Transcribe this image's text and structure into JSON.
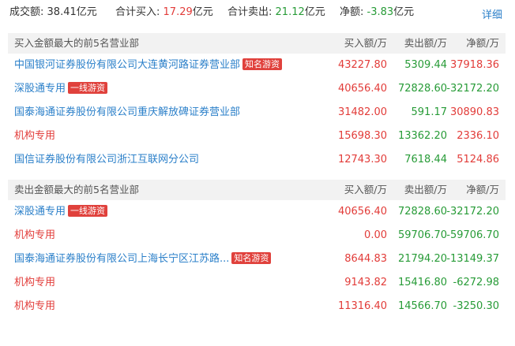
{
  "summary": {
    "turnover_label": "成交额:",
    "turnover_value": "38.41亿元",
    "buy_label": "合计买入:",
    "buy_value": "17.29",
    "buy_unit": "亿元",
    "sell_label": "合计卖出:",
    "sell_value": "21.12",
    "sell_unit": "亿元",
    "net_label": "净额:",
    "net_value": "-3.83",
    "net_unit": "亿元",
    "detail_link": "详细"
  },
  "columns": {
    "buy": "买入额/万",
    "sell": "卖出额/万",
    "net": "净额/万"
  },
  "buy_section": {
    "title": "买入金额最大的前5名营业部",
    "rows": [
      {
        "name": "中国银河证券股份有限公司大连黄河路证券营业部",
        "badge": "知名游资",
        "buy": "43227.80",
        "sell": "5309.44",
        "net": "37918.36"
      },
      {
        "name": "深股通专用",
        "badge": "一线游资",
        "buy": "40656.40",
        "sell": "72828.60",
        "net": "-32172.20"
      },
      {
        "name": "国泰海通证券股份有限公司重庆解放碑证券营业部",
        "badge": "",
        "buy": "31482.00",
        "sell": "591.17",
        "net": "30890.83"
      },
      {
        "name": "机构专用",
        "badge": "",
        "buy": "15698.30",
        "sell": "13362.20",
        "net": "2336.10"
      },
      {
        "name": "国信证券股份有限公司浙江互联网分公司",
        "badge": "",
        "buy": "12743.30",
        "sell": "7618.44",
        "net": "5124.86"
      }
    ]
  },
  "sell_section": {
    "title": "卖出金额最大的前5名营业部",
    "rows": [
      {
        "name": "深股通专用",
        "badge": "一线游资",
        "buy": "40656.40",
        "sell": "72828.60",
        "net": "-32172.20"
      },
      {
        "name": "机构专用",
        "badge": "",
        "buy": "0.00",
        "sell": "59706.70",
        "net": "-59706.70"
      },
      {
        "name": "国泰海通证券股份有限公司上海长宁区江苏路...",
        "badge": "知名游资",
        "buy": "8644.83",
        "sell": "21794.20",
        "net": "-13149.37"
      },
      {
        "name": "机构专用",
        "badge": "",
        "buy": "9143.82",
        "sell": "15416.80",
        "net": "-6272.98"
      },
      {
        "name": "机构专用",
        "badge": "",
        "buy": "11316.40",
        "sell": "14566.70",
        "net": "-3250.30"
      }
    ]
  }
}
